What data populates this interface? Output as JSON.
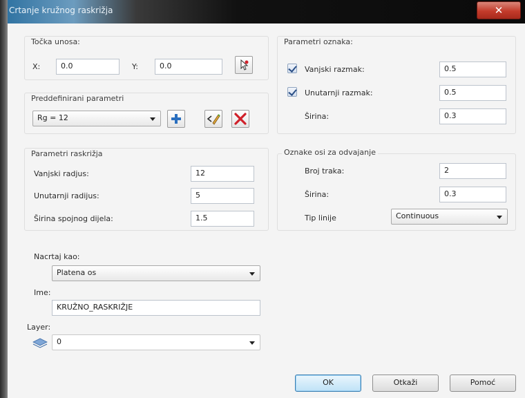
{
  "window": {
    "title": "Crtanje kružnog raskrižja",
    "close_glyph": "✕"
  },
  "insert_point": {
    "legend": "Točka unosa:",
    "x_label": "X:",
    "x_value": "0.0",
    "y_label": "Y:",
    "y_value": "0.0",
    "pick_icon": "pick-point-icon"
  },
  "presets": {
    "legend": "Preddefinirani parametri",
    "selected": "Rg = 12",
    "icons": [
      "add-icon",
      "edit-icon",
      "delete-icon"
    ]
  },
  "intersection": {
    "legend": "Parametri raskrižja",
    "outer_radius_label": "Vanjski radjus:",
    "outer_radius_value": "12",
    "inner_radius_label": "Unutarnji radijus:",
    "inner_radius_value": "5",
    "width_label": "Širina spojnog dijela:",
    "width_value": "1.5"
  },
  "markings": {
    "legend": "Parametri oznaka:",
    "outer_spacing_label": "Vanjski razmak:",
    "outer_spacing_checked": true,
    "outer_spacing_value": "0.5",
    "inner_spacing_label": "Unutarnji razmak:",
    "inner_spacing_checked": true,
    "inner_spacing_value": "0.5",
    "width_label": "Širina:",
    "width_value": "0.3"
  },
  "separator": {
    "legend": "Oznake osi za odvajanje",
    "lanes_label": "Broj traka:",
    "lanes_value": "2",
    "width_label": "Širina:",
    "width_value": "0.3",
    "linetype_label": "Tip linije",
    "linetype_value": "Continuous"
  },
  "draw_as": {
    "label": "Nacrtaj kao:",
    "value": "Platena os"
  },
  "name": {
    "label": "Ime:",
    "value": "KRUŽNO_RASKRIŽJE"
  },
  "layer": {
    "label": "Layer:",
    "value": "0",
    "icon": "layer-icon"
  },
  "buttons": {
    "ok": "OK",
    "cancel": "Otkaži",
    "help": "Pomoć"
  },
  "colors": {
    "accent": "#3c7fb1",
    "delete": "#d0202a",
    "add": "#2a6fbf"
  }
}
